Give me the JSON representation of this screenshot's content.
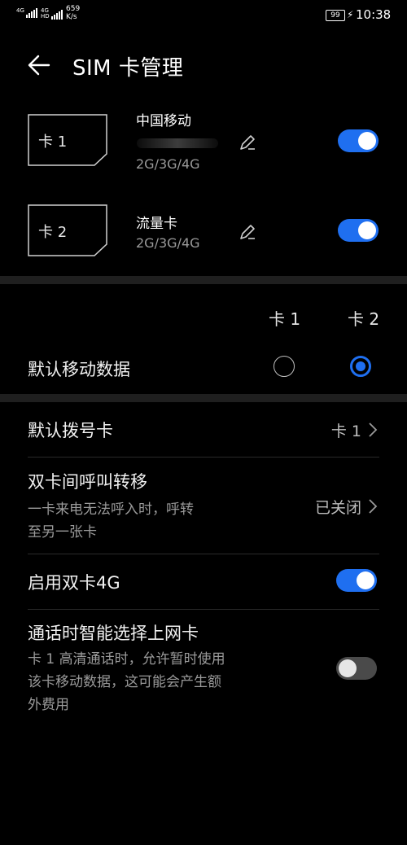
{
  "status_bar": {
    "sim1_network": "4G",
    "sim2_network": "4G",
    "sim2_network_sub": "HD",
    "speed_value": "659",
    "speed_unit": "K/s",
    "battery": "99",
    "time": "10:38"
  },
  "header": {
    "title": "SIM 卡管理"
  },
  "sims": [
    {
      "card_label": "卡 1",
      "name": "中国移动",
      "network": "2G/3G/4G",
      "enabled": true
    },
    {
      "card_label": "卡 2",
      "name": "流量卡",
      "network": "2G/3G/4G",
      "enabled": true
    }
  ],
  "mobile_data": {
    "col1": "卡 1",
    "col2": "卡 2",
    "label": "默认移动数据",
    "selected": "卡 2"
  },
  "default_dial": {
    "label": "默认拨号卡",
    "value": "卡 1"
  },
  "call_forward": {
    "label": "双卡间呼叫转移",
    "desc_line1": "一卡来电无法呼入时，呼转",
    "desc_line2": "至另一张卡",
    "value": "已关闭"
  },
  "dual_4g": {
    "label": "启用双卡4G",
    "enabled": true
  },
  "smart_data": {
    "label": "通话时智能选择上网卡",
    "desc_line1": "卡 1 高清通话时，允许暂时使用",
    "desc_line2": "该卡移动数据，这可能会产生额",
    "desc_line3": "外费用",
    "enabled": false
  },
  "colors": {
    "accent": "#1f6ff0",
    "background": "#000000",
    "divider": "#1f1f1f"
  }
}
